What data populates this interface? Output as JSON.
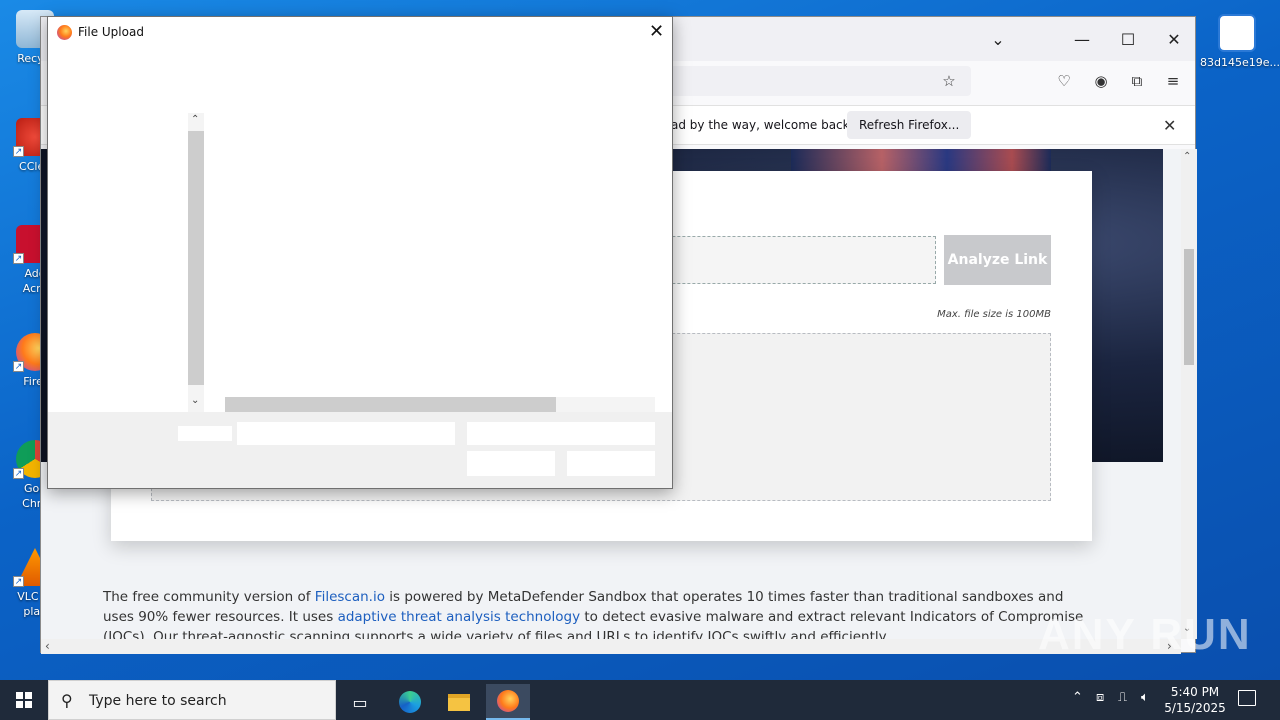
{
  "desktop": {
    "icons": [
      {
        "label": "Recycle Bin",
        "visible_label": "Recycl"
      },
      {
        "label": "CCleaner",
        "visible_label": "CClea"
      },
      {
        "label": "Adobe Acrobat",
        "visible_label": "Ado\nAcro"
      },
      {
        "label": "Firefox",
        "visible_label": "Firef"
      },
      {
        "label": "Google Chrome",
        "visible_label": "Goo\nChro"
      },
      {
        "label": "VLC media player",
        "visible_label": "VLC m\nplay"
      }
    ],
    "right_icon_label": "83d145e19e..."
  },
  "browser": {
    "notification": {
      "text": "ad by the way, welcome back!",
      "refresh_label": "Refresh Firefox..."
    },
    "page": {
      "analyze_label": "Analyze Link",
      "max_size": "Max. file size is 100MB",
      "para_pre1": "The free community version of ",
      "para_link1": "Filescan.io",
      "para_mid1": " is powered by MetaDefender Sandbox that operates 10 times faster than traditional sandboxes and uses 90% fewer resources. It uses ",
      "para_link2": "adaptive threat analysis technology",
      "para_post": " to detect evasive malware and extract relevant Indicators of Compromise (IOCs). Our threat-agnostic scanning supports a wide variety of files and URLs to identify IOCs swiftly and efficiently."
    }
  },
  "dialog": {
    "title": "File Upload"
  },
  "taskbar": {
    "search_placeholder": "Type here to search",
    "time": "5:40 PM",
    "date": "5/15/2025"
  },
  "watermark": "ANY RUN",
  "colors": {
    "accent": "#0a5fc4",
    "link": "#1d5fbf",
    "taskbar": "#1f2a3a"
  }
}
